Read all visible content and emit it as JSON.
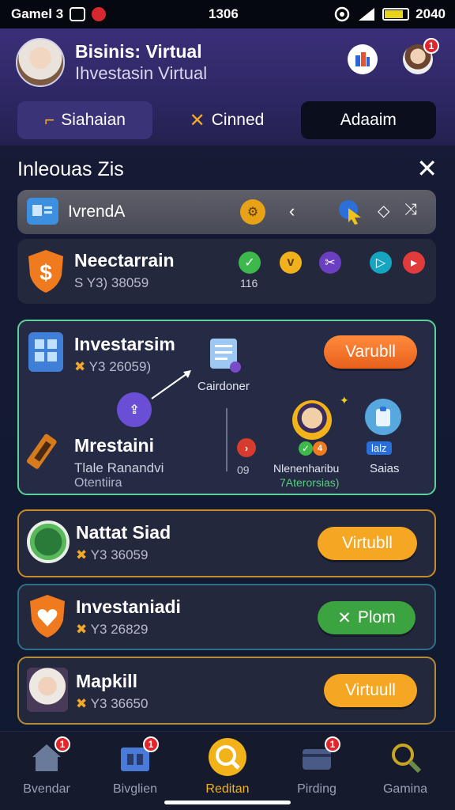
{
  "status": {
    "carrier": "Gamel 3",
    "time": "1306",
    "battery_text": "2040"
  },
  "header": {
    "title": "Bisinis: Virtual",
    "subtitle": "Ihvestasin Virtual",
    "notif_count": "1"
  },
  "tabs": [
    {
      "label": "Siahaian",
      "icon": "bracket-icon"
    },
    {
      "label": "Cinned",
      "icon": "cross-icon"
    },
    {
      "label": "Adaaim",
      "icon": ""
    }
  ],
  "section": {
    "title": "Inleouas Zis"
  },
  "filter_bar": {
    "label": "IvrendA"
  },
  "row1": {
    "title": "Neectarrain",
    "subtitle": "S Y3) 38059",
    "count": "116"
  },
  "featured": {
    "title": "Investarsim",
    "subtitle": "Y3 26059)",
    "button": "Varubll",
    "node_label": "Cairdoner",
    "item_title": "Mrestaini",
    "item_sub1": "Tlale Ranandvi",
    "item_sub2": "Otentiira",
    "small_num": "09",
    "person_label": "Nlenenharibu",
    "person_sub": "7Aterorsias)",
    "sales_badge": "lalz",
    "sales_label": "Saias",
    "mini_badge": "4"
  },
  "list": [
    {
      "title": "Nattat Siad",
      "subtitle": "Y3 36059",
      "button": "Virtubll",
      "btn_color": "#f5a623",
      "border": "#c98a2c"
    },
    {
      "title": "Investaniadi",
      "subtitle": "Y3 26829",
      "button": "Plom",
      "btn_color": "#3ba33f",
      "border": "#2f6f8a"
    },
    {
      "title": "Mapkill",
      "subtitle": "Y3 36650",
      "button": "Virtuull",
      "btn_color": "#f5a623",
      "border": "#b58a3a"
    }
  ],
  "nav": [
    {
      "label": "Bvendar",
      "badge": "1",
      "icon": "home-icon"
    },
    {
      "label": "Bivglien",
      "badge": "1",
      "icon": "store-icon"
    },
    {
      "label": "Reditan",
      "badge": "",
      "icon": "search-coin-icon",
      "active": true
    },
    {
      "label": "Pirding",
      "badge": "1",
      "icon": "wallet-icon"
    },
    {
      "label": "Gamina",
      "badge": "",
      "icon": "magnifier-icon"
    }
  ],
  "colors": {
    "accent": "#f5a623",
    "green": "#3ba33f",
    "featured_border": "#5cd19a",
    "active_nav": "#f2b21a"
  }
}
